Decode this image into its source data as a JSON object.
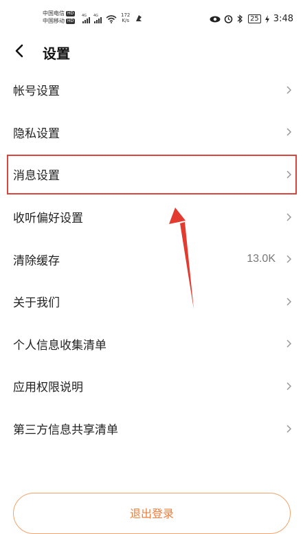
{
  "status_bar": {
    "carrier1": "中国电信",
    "carrier2": "中国移动",
    "hd": "HD",
    "net1": "4G",
    "net2": "4G",
    "speed_value": "172",
    "speed_unit": "K/s",
    "battery": "25",
    "time": "3:48"
  },
  "header": {
    "title": "设置"
  },
  "menu": {
    "items": [
      {
        "label": "帐号设置",
        "value": ""
      },
      {
        "label": "隐私设置",
        "value": ""
      },
      {
        "label": "消息设置",
        "value": ""
      },
      {
        "label": "收听偏好设置",
        "value": ""
      },
      {
        "label": "清除缓存",
        "value": "13.0K"
      },
      {
        "label": "关于我们",
        "value": ""
      },
      {
        "label": "个人信息收集清单",
        "value": ""
      },
      {
        "label": "应用权限说明",
        "value": ""
      },
      {
        "label": "第三方信息共享清单",
        "value": ""
      }
    ]
  },
  "logout": {
    "label": "退出登录"
  },
  "colors": {
    "highlight": "#d9453d",
    "accent": "#ee7d3a"
  }
}
